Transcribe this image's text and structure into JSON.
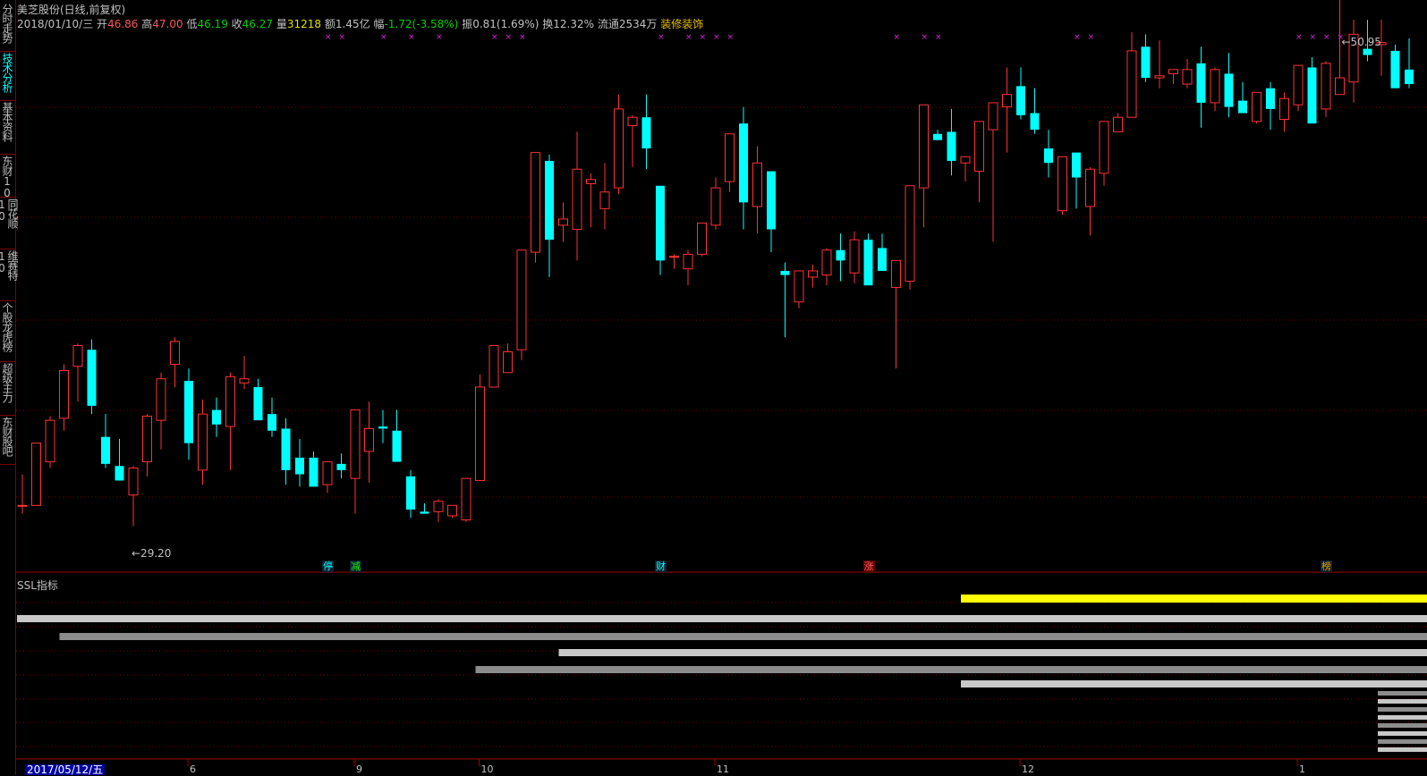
{
  "sidebar": {
    "tabs": [
      {
        "label": "分时走势",
        "active": false
      },
      {
        "label": "技术分析",
        "active": true
      },
      {
        "label": "基本资料",
        "active": false
      },
      {
        "label": "东财10",
        "active": false
      },
      {
        "label": "同花顺10",
        "active": false
      },
      {
        "label": "维赛特10",
        "active": false
      },
      {
        "label": "个股龙虎榜",
        "active": false
      },
      {
        "label": "超级主力",
        "active": false
      },
      {
        "label": "东财股吧",
        "active": false
      }
    ]
  },
  "header": {
    "title": "美芝股份(日线,前复权)",
    "date": "2018/01/10/三",
    "open_label": "开",
    "open": "46.86",
    "high_label": "高",
    "high": "47.00",
    "low_label": "低",
    "low": "46.19",
    "close_label": "收",
    "close": "46.27",
    "volume_label": "量",
    "volume": "31218",
    "amount_label": "额",
    "amount": "1.45亿",
    "change_label": "幅",
    "change": "-1.72(-3.58%)",
    "amplitude_label": "振",
    "amplitude": "0.81(1.69%)",
    "turnover_label": "换",
    "turnover": "12.32%",
    "float_label": "流通",
    "float": "2534万",
    "industry": "装修装饰"
  },
  "chart_data": {
    "type": "candlestick",
    "price_range": [
      27.5,
      53.0
    ],
    "high_annotation": "50.95",
    "low_annotation": "29.20",
    "candles": [
      [
        30.2,
        31.7,
        29.8,
        30.2
      ],
      [
        30.2,
        33.2,
        30.2,
        33.2
      ],
      [
        32.3,
        34.5,
        32.0,
        34.3
      ],
      [
        34.4,
        37.0,
        33.8,
        36.7
      ],
      [
        36.9,
        38.0,
        35.2,
        37.9
      ],
      [
        37.7,
        38.2,
        34.6,
        35.0
      ],
      [
        33.5,
        34.6,
        32.0,
        32.2
      ],
      [
        32.1,
        33.4,
        31.8,
        31.4
      ],
      [
        30.7,
        32.1,
        29.2,
        32.0
      ],
      [
        32.3,
        34.6,
        31.6,
        34.5
      ],
      [
        34.3,
        36.6,
        32.9,
        36.3
      ],
      [
        37.0,
        38.3,
        35.9,
        38.1
      ],
      [
        36.2,
        36.8,
        32.4,
        33.2
      ],
      [
        31.9,
        35.3,
        31.2,
        34.6
      ],
      [
        34.8,
        35.4,
        33.5,
        34.1
      ],
      [
        34.0,
        36.6,
        31.9,
        36.4
      ],
      [
        36.1,
        37.4,
        35.8,
        36.3
      ],
      [
        35.9,
        36.3,
        34.6,
        34.3
      ],
      [
        34.6,
        35.4,
        33.5,
        33.8
      ],
      [
        33.9,
        34.4,
        31.2,
        31.9
      ],
      [
        32.5,
        33.4,
        31.1,
        31.7
      ],
      [
        32.5,
        32.8,
        31.2,
        31.1
      ],
      [
        31.2,
        32.0,
        30.8,
        32.3
      ],
      [
        32.2,
        32.7,
        31.5,
        31.9
      ],
      [
        31.5,
        34.8,
        29.8,
        34.8
      ],
      [
        32.8,
        35.2,
        31.3,
        33.9
      ],
      [
        34.0,
        34.8,
        33.2,
        33.9
      ],
      [
        33.8,
        34.8,
        33.0,
        32.3
      ],
      [
        31.6,
        31.9,
        29.6,
        30.0
      ],
      [
        29.9,
        30.3,
        29.8,
        29.8
      ],
      [
        29.9,
        30.5,
        29.4,
        30.4
      ],
      [
        29.7,
        30.2,
        29.6,
        30.2
      ],
      [
        29.5,
        31.5,
        29.4,
        31.5
      ],
      [
        31.4,
        36.5,
        31.5,
        35.9
      ],
      [
        35.9,
        37.9,
        35.9,
        37.9
      ],
      [
        36.6,
        38.0,
        36.6,
        37.6
      ],
      [
        37.7,
        42.3,
        37.2,
        42.5
      ],
      [
        42.4,
        47.2,
        41.9,
        47.2
      ],
      [
        46.8,
        47.1,
        41.2,
        43.0
      ],
      [
        43.7,
        44.8,
        42.9,
        44.0
      ],
      [
        43.5,
        48.2,
        42.0,
        46.4
      ],
      [
        45.7,
        46.2,
        43.6,
        45.9
      ],
      [
        44.5,
        46.7,
        43.5,
        45.3
      ],
      [
        45.5,
        50.0,
        45.2,
        49.3
      ],
      [
        48.5,
        49.0,
        46.5,
        48.9
      ],
      [
        48.9,
        50.0,
        46.4,
        47.4
      ],
      [
        45.6,
        45.6,
        41.3,
        42.0
      ],
      [
        42.2,
        42.3,
        41.6,
        42.2
      ],
      [
        41.6,
        42.5,
        40.8,
        42.3
      ],
      [
        42.3,
        43.3,
        42.2,
        43.8
      ],
      [
        43.7,
        46.0,
        43.5,
        45.5
      ],
      [
        45.8,
        47.8,
        45.3,
        48.1
      ],
      [
        48.6,
        49.4,
        43.5,
        44.8
      ],
      [
        44.6,
        47.5,
        43.3,
        46.7
      ],
      [
        46.3,
        46.3,
        42.4,
        43.5
      ],
      [
        41.5,
        41.9,
        38.3,
        41.3
      ],
      [
        40.0,
        41.3,
        39.7,
        41.5
      ],
      [
        41.2,
        41.8,
        40.7,
        41.5
      ],
      [
        41.3,
        42.6,
        40.8,
        42.5
      ],
      [
        42.5,
        43.3,
        41.0,
        42.0
      ],
      [
        41.4,
        43.4,
        40.9,
        43.0
      ],
      [
        43.0,
        43.3,
        41.3,
        40.8
      ],
      [
        42.6,
        43.3,
        41.9,
        41.5
      ],
      [
        40.7,
        41.5,
        36.8,
        42.0
      ],
      [
        41.0,
        45.6,
        40.6,
        45.6
      ],
      [
        45.5,
        49.5,
        43.6,
        49.5
      ],
      [
        48.1,
        48.3,
        47.8,
        47.8
      ],
      [
        48.2,
        49.3,
        46.1,
        46.8
      ],
      [
        46.7,
        46.9,
        45.8,
        47.0
      ],
      [
        46.3,
        47.6,
        44.8,
        48.7
      ],
      [
        48.3,
        49.6,
        42.9,
        49.6
      ],
      [
        49.4,
        51.3,
        47.2,
        50.0
      ],
      [
        50.4,
        51.3,
        48.8,
        49.0
      ],
      [
        49.1,
        50.3,
        48.1,
        48.3
      ],
      [
        47.4,
        48.3,
        46.0,
        46.7
      ],
      [
        44.4,
        46.5,
        44.2,
        47.0
      ],
      [
        47.2,
        47.2,
        44.5,
        46.0
      ],
      [
        44.6,
        46.5,
        43.2,
        46.4
      ],
      [
        46.2,
        48.7,
        45.6,
        48.7
      ],
      [
        48.2,
        49.1,
        48.4,
        48.9
      ],
      [
        48.9,
        53.0,
        48.9,
        52.1
      ],
      [
        52.3,
        52.9,
        50.6,
        50.8
      ],
      [
        50.8,
        52.6,
        50.3,
        50.9
      ],
      [
        51.0,
        51.1,
        50.5,
        51.2
      ],
      [
        50.5,
        51.7,
        50.3,
        51.2
      ],
      [
        51.5,
        52.3,
        48.4,
        49.6
      ],
      [
        49.6,
        51.3,
        49.2,
        51.2
      ],
      [
        51.0,
        52.0,
        48.9,
        49.4
      ],
      [
        49.7,
        50.6,
        49.4,
        49.1
      ],
      [
        48.7,
        50.1,
        48.6,
        50.1
      ],
      [
        50.3,
        50.6,
        48.3,
        49.3
      ],
      [
        48.8,
        50.1,
        48.2,
        49.8
      ],
      [
        49.5,
        51.0,
        49.2,
        51.4
      ],
      [
        51.3,
        51.8,
        48.8,
        48.6
      ],
      [
        49.3,
        51.6,
        48.9,
        51.5
      ],
      [
        50.0,
        58.0,
        50.5,
        50.8
      ],
      [
        50.6,
        53.6,
        49.6,
        52.9
      ],
      [
        52.2,
        53.6,
        51.6,
        51.9
      ],
      [
        52.4,
        53.6,
        50.9,
        52.5
      ],
      [
        52.1,
        52.4,
        50.6,
        50.3
      ],
      [
        51.2,
        52.7,
        50.3,
        50.5
      ]
    ],
    "event_markers": [
      {
        "label": "停",
        "index": 22,
        "color": "#00ffff"
      },
      {
        "label": "减",
        "index": 24,
        "color": "#00ff00"
      },
      {
        "label": "财",
        "index": 46,
        "color": "#00ffff"
      },
      {
        "label": "涨",
        "index": 61,
        "color": "#ff6060"
      },
      {
        "label": "榜",
        "index": 94,
        "color": "#e8a000"
      }
    ],
    "indicator": {
      "title": "SSL指标",
      "bars": [
        {
          "start_index": 68,
          "level": 0,
          "color": "#ffff00"
        },
        {
          "start_index": 0,
          "level": 1,
          "color": "#c8c8c8"
        },
        {
          "start_index": 3,
          "level": 2,
          "color": "#8c8c8c"
        },
        {
          "start_index": 39,
          "level": 3,
          "color": "#c8c8c8"
        },
        {
          "start_index": 33,
          "level": 4,
          "color": "#8c8c8c"
        },
        {
          "start_index": 68,
          "level": 5,
          "color": "#c8c8c8"
        }
      ]
    },
    "x_axis": {
      "date_label": "2017/05/12/五",
      "month_ticks": [
        {
          "label": "6",
          "index": 12
        },
        {
          "label": "9",
          "index": 24
        },
        {
          "label": "10",
          "index": 33
        },
        {
          "label": "11",
          "index": 50
        },
        {
          "label": "12",
          "index": 72
        },
        {
          "label": "1",
          "index": 92
        }
      ]
    }
  }
}
